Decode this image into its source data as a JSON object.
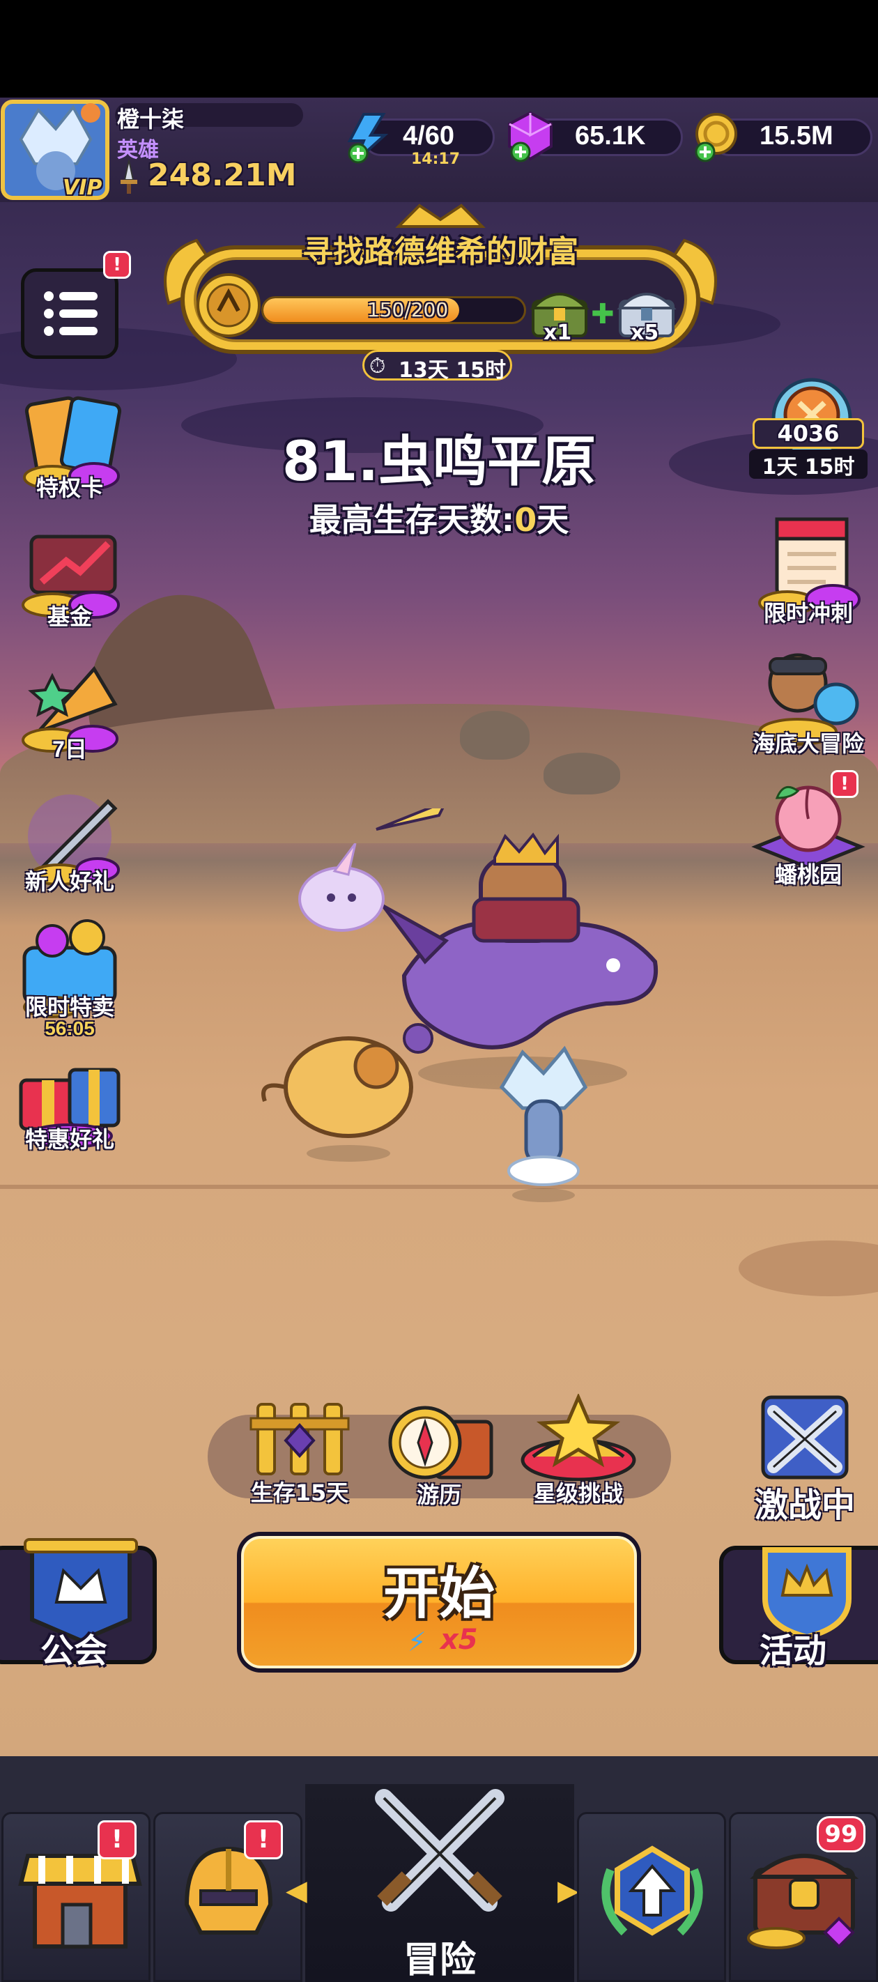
{
  "player": {
    "name": "橙十柒",
    "rank": "英雄",
    "vip_label": "VIP",
    "power": "248.21M"
  },
  "resources": {
    "energy": "4/60",
    "energy_timer": "14:17",
    "gems": "65.1K",
    "gold": "15.5M"
  },
  "event": {
    "title": "寻找路德维希的财富",
    "progress_text": "150/200",
    "progress_fraction": 0.75,
    "reward_1_count": "x1",
    "reward_2_count": "x5",
    "timer": "13天 15时"
  },
  "stage": {
    "name": "81.虫鸣平原",
    "best_survival_label": "最高生存天数:",
    "best_survival_value": "0",
    "best_survival_unit": "天"
  },
  "left_menu": [
    {
      "label": "特权卡",
      "icon": "privilege-card-icon"
    },
    {
      "label": "基金",
      "icon": "fund-icon"
    },
    {
      "label": "7日",
      "icon": "seven-day-icon"
    },
    {
      "label": "新人好礼",
      "icon": "newbie-gift-icon"
    },
    {
      "label": "限时特卖",
      "icon": "limited-sale-icon",
      "timer": "56:05"
    },
    {
      "label": "特惠好礼",
      "icon": "special-gift-icon"
    }
  ],
  "right_menu": {
    "arena_score": "4036",
    "arena_timer": "1天 15时",
    "items": [
      {
        "label": "限时冲刺",
        "icon": "limited-sprint-icon"
      },
      {
        "label": "海底大冒险",
        "icon": "undersea-adventure-icon"
      },
      {
        "label": "蟠桃园",
        "icon": "peach-garden-icon"
      }
    ]
  },
  "mode_bar": {
    "survival": "生存15天",
    "travel": "游历",
    "star_challenge": "星级挑战",
    "battle": "激战中"
  },
  "actions": {
    "guild": "公会",
    "start": "开始",
    "start_cost": "x5",
    "events": "活动"
  },
  "bottom_nav": {
    "adventure": "冒险",
    "chest_badge": "99",
    "alert": "!"
  },
  "colors": {
    "accent_orange": "#f7a224",
    "gold": "#f3c33c",
    "badge_red": "#e8324f",
    "panel_dark": "#2c223f"
  }
}
